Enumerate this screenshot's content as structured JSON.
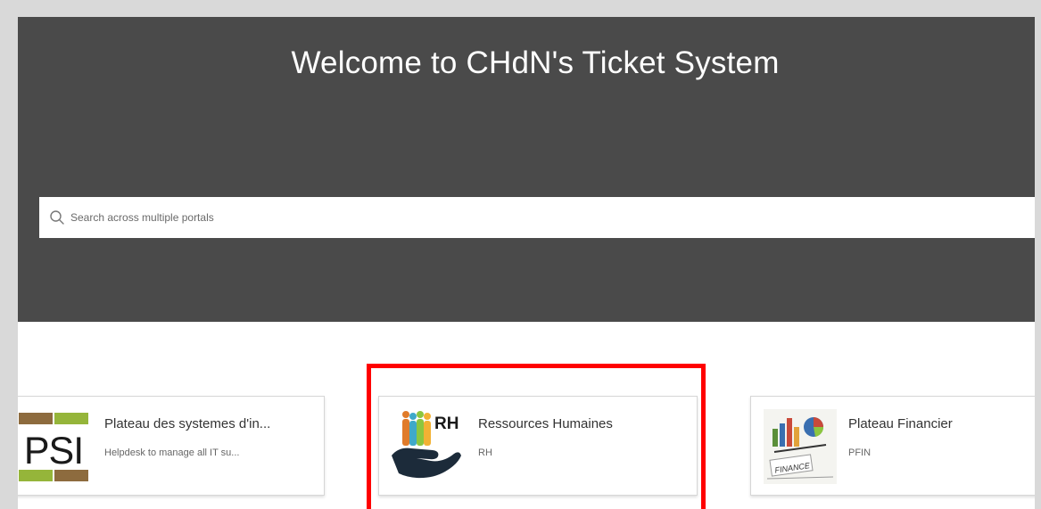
{
  "hero": {
    "title": "Welcome to CHdN's Ticket System"
  },
  "search": {
    "placeholder": "Search across multiple portals",
    "icon": "search-icon"
  },
  "portals": [
    {
      "name": "Plateau des systemes d'in...",
      "description": "Helpdesk to manage all IT su...",
      "logo_text": "PSI",
      "logo_colors": [
        "#8d6b3e",
        "#95b53a"
      ]
    },
    {
      "name": "Ressources Humaines",
      "description": "RH",
      "logo_text": "RH",
      "highlighted": true
    },
    {
      "name": "Plateau Financier",
      "description": "PFIN",
      "logo_text": "FINANCE"
    }
  ],
  "colors": {
    "hero_background": "#4a4a4a",
    "highlight": "#ff0000"
  }
}
